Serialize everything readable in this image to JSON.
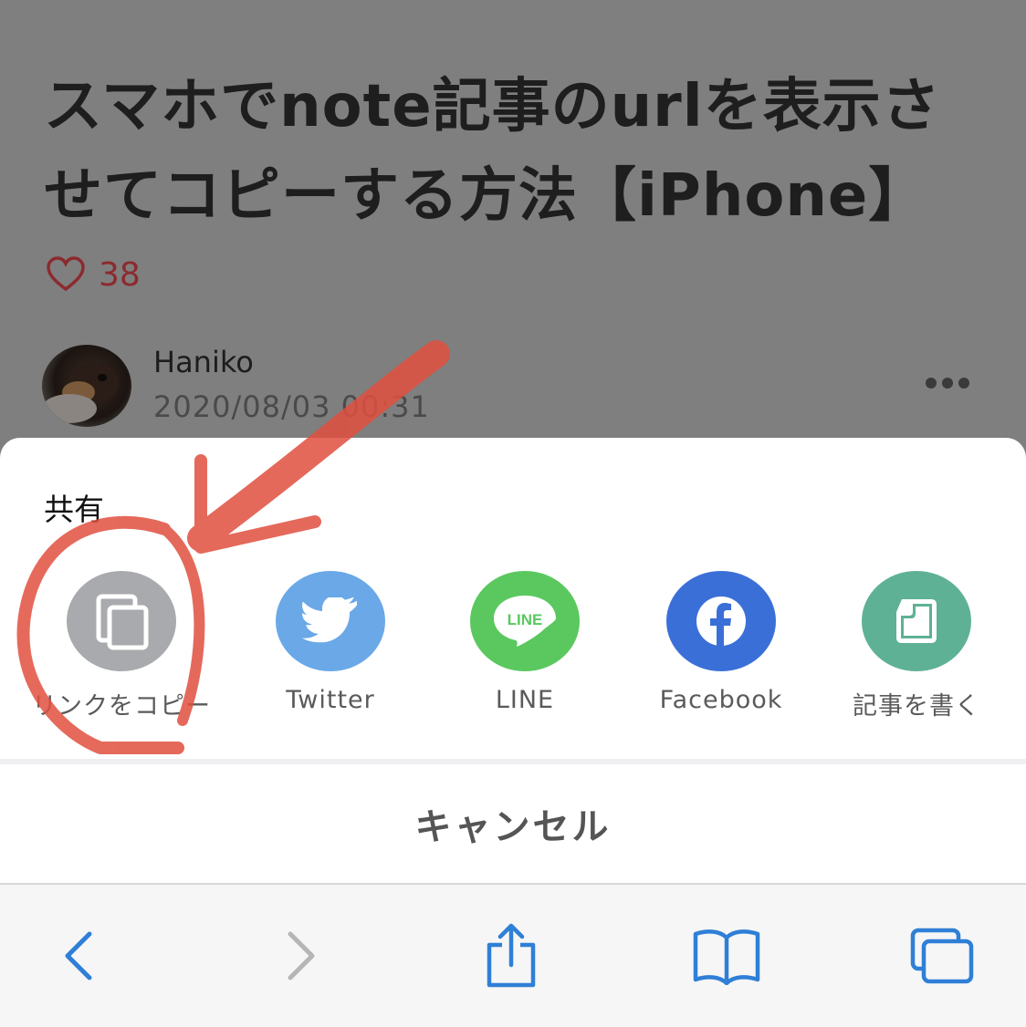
{
  "article": {
    "title": "スマホでnote記事のurlを表示させてコピーする方法【iPhone】",
    "like_count": "38",
    "author_name": "Haniko",
    "published": "2020/08/03 00:31"
  },
  "share_sheet": {
    "title": "共有",
    "items": [
      {
        "label": "リンクをコピー",
        "icon": "copy-icon",
        "color": "#a9aaad"
      },
      {
        "label": "Twitter",
        "icon": "twitter-bird-icon",
        "color": "#6aa8e8"
      },
      {
        "label": "LINE",
        "icon": "line-icon",
        "color": "#5ac85f",
        "icon_text": "LINE"
      },
      {
        "label": "Facebook",
        "icon": "facebook-icon",
        "color": "#3b6fd8"
      },
      {
        "label": "記事を書く",
        "icon": "note-icon",
        "color": "#5eb195"
      }
    ],
    "cancel_label": "キャンセル"
  },
  "toolbar": {
    "icons": [
      "back-icon",
      "forward-icon",
      "share-icon",
      "bookmarks-icon",
      "tabs-icon"
    ],
    "accent": "#2f7fd6"
  },
  "annotation_color": "#e0503f"
}
